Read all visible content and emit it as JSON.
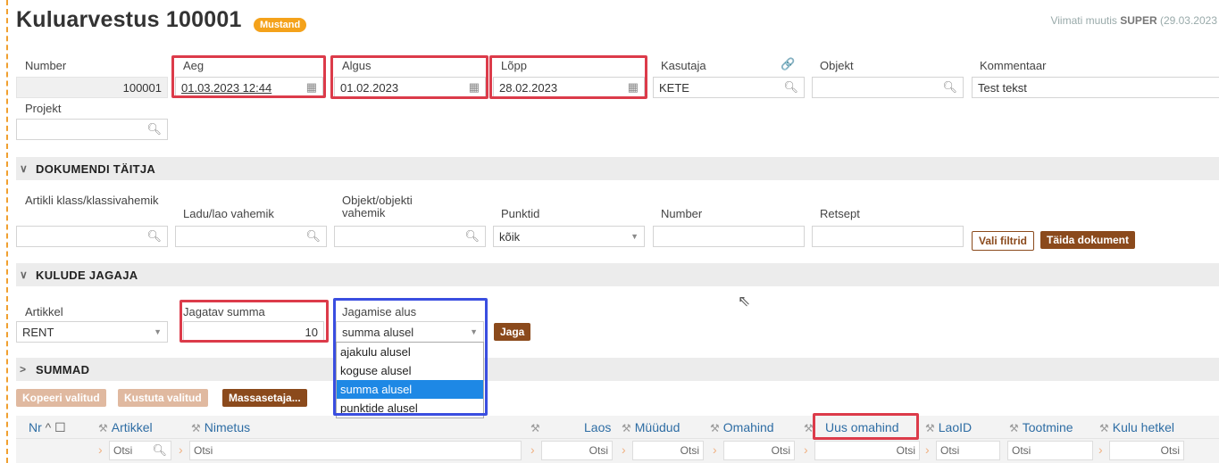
{
  "header": {
    "title": "Kuluarvestus 100001",
    "status_badge": "Mustand",
    "last_modified": "Viimati muutis SUPER (29.03.2023"
  },
  "fields": {
    "number_label": "Number",
    "number_value": "100001",
    "aeg_label": "Aeg",
    "aeg_value": "01.03.2023 12:44",
    "algus_label": "Algus",
    "algus_value": "01.02.2023",
    "lopp_label": "Lõpp",
    "lopp_value": "28.02.2023",
    "kasutaja_label": "Kasutaja",
    "kasutaja_value": "KETE",
    "objekt_label": "Objekt",
    "objekt_value": "",
    "kommentaar_label": "Kommentaar",
    "kommentaar_value": "Test tekst",
    "projekt_label": "Projekt",
    "projekt_value": ""
  },
  "section_taitja": {
    "title": "DOKUMENDI TÄITJA",
    "artikli_label": "Artikli klass/klassivahemik",
    "ladu_label": "Ladu/lao vahemik",
    "objekt_label": "Objekt/objekti vahemik",
    "punktid_label": "Punktid",
    "punktid_value": "kõik",
    "number_label": "Number",
    "retsept_label": "Retsept",
    "vali_filtrid": "Vali filtrid",
    "taida_dokument": "Täida dokument"
  },
  "section_jagaja": {
    "title": "KULUDE JAGAJA",
    "artikkel_label": "Artikkel",
    "artikkel_value": "RENT",
    "jagatav_label": "Jagatav summa",
    "jagatav_value": "10",
    "alus_label": "Jagamise alus",
    "alus_value": "summa alusel",
    "jaga_button": "Jaga",
    "alus_options": [
      "ajakulu alusel",
      "koguse alusel",
      "summa alusel",
      "punktide alusel"
    ],
    "alus_selected_index": 2
  },
  "section_summad": {
    "title": "SUMMAD"
  },
  "toolbar": {
    "kopeeri": "Kopeeri valitud",
    "kustuta": "Kustuta valitud",
    "massasetaja": "Massasetaja..."
  },
  "grid": {
    "nr": "Nr",
    "artikkel": "Artikkel",
    "nimetus": "Nimetus",
    "laos": "Laos",
    "muudud": "Müüdud",
    "omahind": "Omahind",
    "uus_omahind": "Uus omahind",
    "laoid": "LaoID",
    "tootmine": "Tootmine",
    "kulu_hetkel": "Kulu hetkel",
    "filter_placeholder": "Otsi"
  },
  "colors": {
    "highlight_red": "#dc3b4a",
    "highlight_blue": "#3a4ee0",
    "brand_button": "#8b4a1c",
    "badge": "#f4a21b",
    "link_blue": "#2e6da4"
  }
}
